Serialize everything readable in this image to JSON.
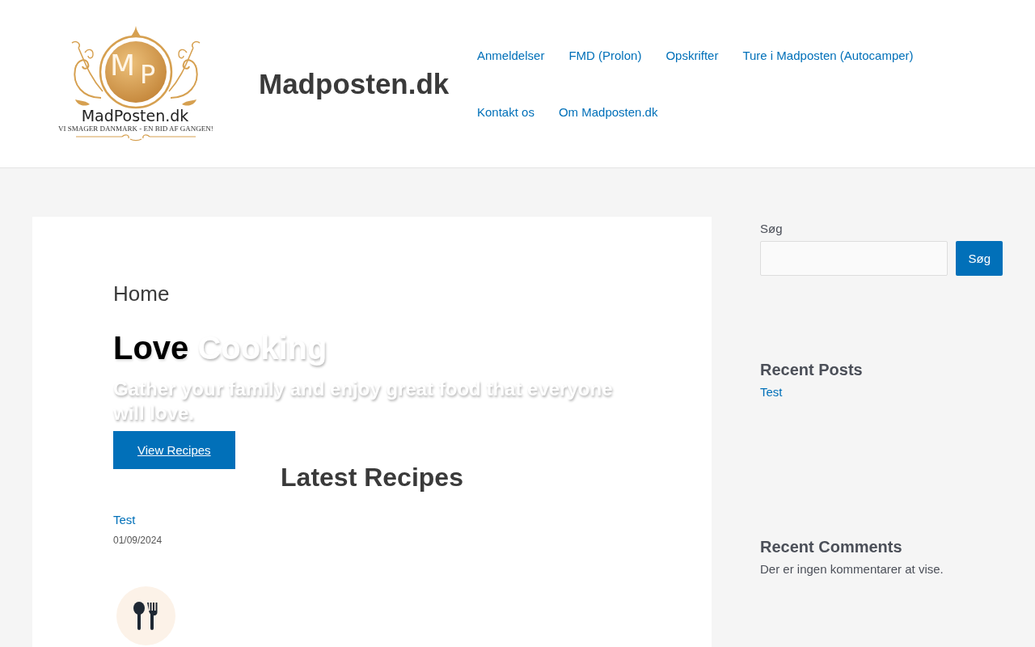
{
  "header": {
    "logo": {
      "monogram": [
        "M",
        "P"
      ],
      "wordmark": "MadPosten.dk",
      "tagline": "VI SMAGER DANMARK - EN BID AF GANGEN!"
    },
    "site_title": "Madposten.dk",
    "nav": [
      "Anmeldelser",
      "FMD (Prolon)",
      "Opskrifter",
      "Ture i Madposten (Autocamper)",
      "Kontakt os",
      "Om Madposten.dk"
    ]
  },
  "main": {
    "page_title": "Home",
    "hero": {
      "heading": [
        {
          "text": "Love",
          "kind": "dark"
        },
        {
          "text": "Cooking",
          "kind": "light"
        }
      ],
      "subtitle": "Gather your family and enjoy great food that everyone will love.",
      "button": "View Recipes"
    },
    "latest": {
      "heading": "Latest Recipes",
      "recipes": [
        {
          "title": "Test",
          "date": "01/09/2024"
        }
      ]
    }
  },
  "sidebar": {
    "search": {
      "label": "Søg",
      "button": "Søg"
    },
    "widgets": [
      {
        "kind": "posts",
        "heading": "Recent Posts",
        "links": [
          "Test"
        ]
      },
      {
        "kind": "comments",
        "heading": "Recent Comments",
        "text": "Der er ingen kommentarer at vise."
      }
    ]
  }
}
